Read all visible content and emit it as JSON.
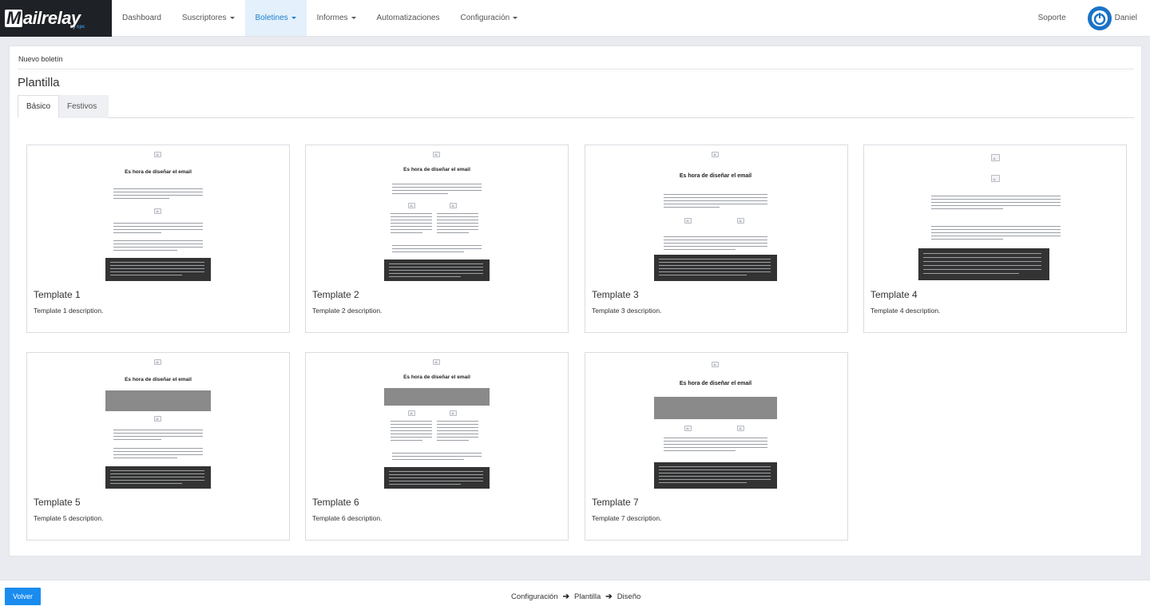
{
  "brand": {
    "name": "ailrelay",
    "initial": "M",
    "by": "by",
    "by_company": "cpc"
  },
  "nav": {
    "items": [
      {
        "label": "Dashboard",
        "caret": false,
        "active": false
      },
      {
        "label": "Suscriptores",
        "caret": true,
        "active": false
      },
      {
        "label": "Boletines",
        "caret": true,
        "active": true
      },
      {
        "label": "Informes",
        "caret": true,
        "active": false
      },
      {
        "label": "Automatizaciones",
        "caret": false,
        "active": false
      },
      {
        "label": "Configuración",
        "caret": true,
        "active": false
      }
    ],
    "support": "Soporte",
    "user": "Daniel"
  },
  "page": {
    "breadcrumb": "Nuevo boletín",
    "title": "Plantilla",
    "tabs": [
      {
        "label": "Básico",
        "active": true
      },
      {
        "label": "Festivos",
        "active": false
      }
    ]
  },
  "templates": [
    {
      "name": "Template 1",
      "description": "Template 1 description.",
      "heading": "Es hora de diseñar el email"
    },
    {
      "name": "Template 2",
      "description": "Template 2 description.",
      "heading": "Es hora de diseñar el email"
    },
    {
      "name": "Template 3",
      "description": "Template 3 description.",
      "heading": "Es hora de diseñar el email"
    },
    {
      "name": "Template 4",
      "description": "Template 4 description.",
      "heading": ""
    },
    {
      "name": "Template 5",
      "description": "Template 5 description.",
      "heading": "Es hora de diseñar el email"
    },
    {
      "name": "Template 6",
      "description": "Template 6 description.",
      "heading": "Es hora de diseñar el email"
    },
    {
      "name": "Template 7",
      "description": "Template 7 description.",
      "heading": "Es hora de diseñar el email"
    }
  ],
  "footer": {
    "back_label": "Volver",
    "steps": [
      "Configuración",
      "Plantilla",
      "Diseño"
    ]
  },
  "colors": {
    "accent": "#1a8cf0",
    "active_tab_bg": "#e4f0fb",
    "logo_bg": "#1e2125"
  }
}
